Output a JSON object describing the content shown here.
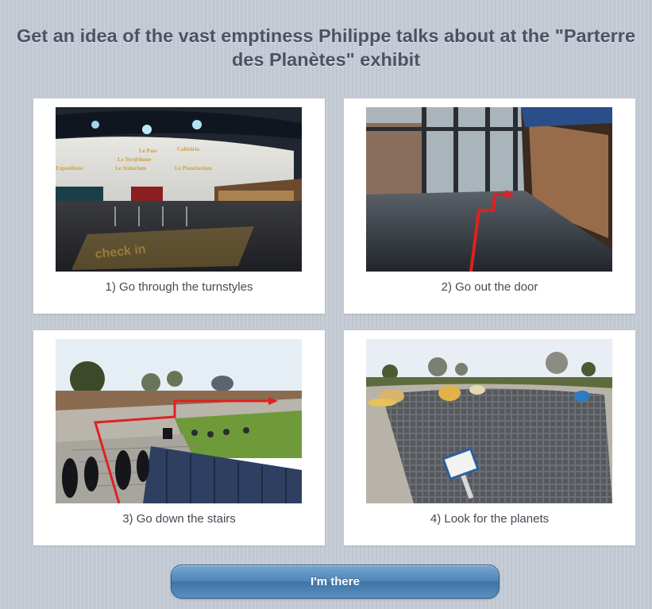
{
  "header": {
    "title": "Get an idea of the vast emptiness Philippe talks about at the \"Parterre des Planètes\" exhibit"
  },
  "steps": [
    {
      "caption": "1) Go through the turnstyles",
      "photo": "lobby-turnstiles-photo"
    },
    {
      "caption": "2) Go out the door",
      "photo": "exit-door-photo"
    },
    {
      "caption": "3) Go down the stairs",
      "photo": "outdoor-stairs-photo"
    },
    {
      "caption": "4) Look for the planets",
      "photo": "planet-garden-photo"
    }
  ],
  "photo_signage": {
    "sign_1": "Le Pass",
    "sign_2": "Le Ter@dome",
    "sign_3": "Le Stelarium",
    "sign_4": "Expositions",
    "sign_5": "Le Planétarium",
    "sign_6": "Cafétéria",
    "floor_text": "check in"
  },
  "actions": {
    "confirm_label": "I'm there"
  },
  "colors": {
    "background": "#c3cad4",
    "title": "#4a5364",
    "button": "#4f86b9",
    "route_arrow": "#e02020"
  }
}
